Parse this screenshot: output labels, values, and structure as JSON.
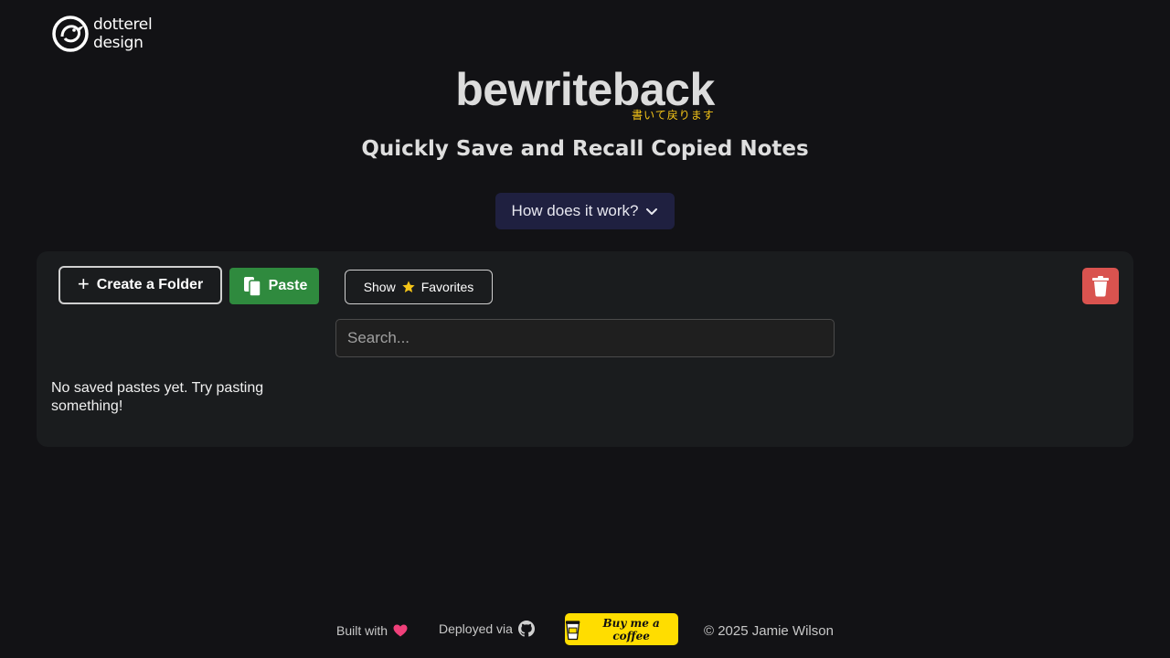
{
  "brand": {
    "logo_line1": "dotterel",
    "logo_line2": "design"
  },
  "header": {
    "title": "bewriteback",
    "title_japanese": "書いて戻ります",
    "subtitle": "Quickly Save and Recall Copied Notes",
    "how_button_label": "How does it work?"
  },
  "toolbar": {
    "create_folder_label": "Create a Folder",
    "paste_label": "Paste",
    "favorites_show_label": "Show",
    "favorites_label": "Favorites"
  },
  "search": {
    "placeholder": "Search...",
    "value": ""
  },
  "pastes": {
    "empty_message": "No saved pastes yet. Try pasting something!"
  },
  "footer": {
    "built_with": "Built with",
    "deployed_via": "Deployed via",
    "coffee_label": "Buy me a coffee",
    "copyright": "© 2025 Jamie Wilson"
  },
  "colors": {
    "background": "#121215",
    "panel": "#1a1c1e",
    "paste_green": "#2f8a3e",
    "trash_red": "#d9534f",
    "how_button": "#1f2040",
    "accent_yellow": "#f5c518",
    "coffee_yellow": "#ffdd00"
  },
  "icons": {
    "logo": "bird-logo-icon",
    "how_chevron": "chevron-down-icon",
    "create": "plus-icon",
    "paste": "clipboard-icon",
    "favorites": "star-icon",
    "trash": "trash-icon",
    "heart": "heart-icon",
    "github": "github-icon",
    "coffee": "coffee-cup-icon"
  }
}
